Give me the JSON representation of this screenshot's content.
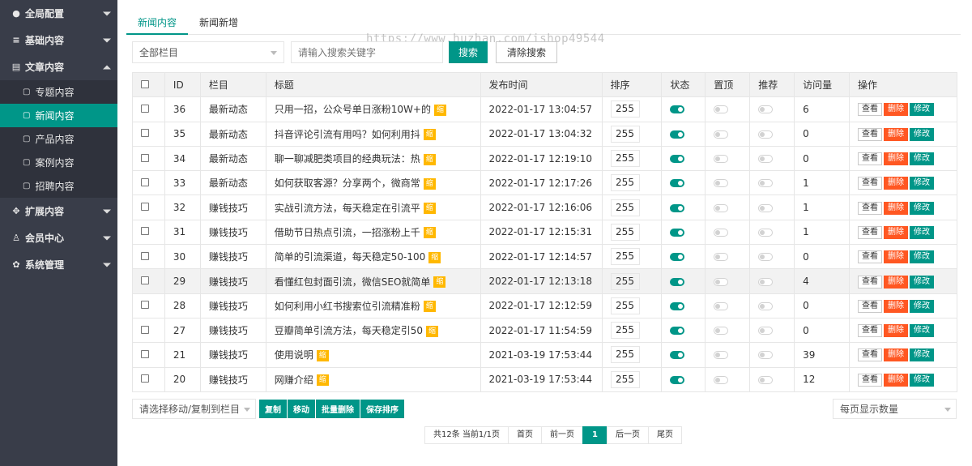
{
  "sidebar": {
    "items": [
      {
        "label": "全局配置",
        "icon": "globe-icon",
        "glyph": "●",
        "expanded": false
      },
      {
        "label": "基础内容",
        "icon": "sliders-icon",
        "glyph": "≡",
        "expanded": false
      },
      {
        "label": "文章内容",
        "icon": "document-icon",
        "glyph": "▤",
        "expanded": true
      },
      {
        "label": "扩展内容",
        "icon": "expand-icon",
        "glyph": "✥",
        "expanded": false
      },
      {
        "label": "会员中心",
        "icon": "user-icon",
        "glyph": "♙",
        "expanded": false
      },
      {
        "label": "系统管理",
        "icon": "gear-icon",
        "glyph": "✿",
        "expanded": false
      }
    ],
    "sub_items": [
      {
        "label": "专题内容",
        "active": false
      },
      {
        "label": "新闻内容",
        "active": true
      },
      {
        "label": "产品内容",
        "active": false
      },
      {
        "label": "案例内容",
        "active": false
      },
      {
        "label": "招聘内容",
        "active": false
      }
    ]
  },
  "tabs": [
    {
      "label": "新闻内容",
      "active": true
    },
    {
      "label": "新闻新增",
      "active": false
    }
  ],
  "watermark": "https://www.huzhan.com/ishop49544",
  "toolbar": {
    "category_select": "全部栏目",
    "search_placeholder": "请输入搜索关键字",
    "search_button": "搜索",
    "clear_button": "清除搜索"
  },
  "table": {
    "columns": [
      "ID",
      "栏目",
      "标题",
      "发布时间",
      "排序",
      "状态",
      "置顶",
      "推荐",
      "访问量",
      "操作"
    ],
    "tag_label": "缩",
    "op_labels": {
      "view": "查看",
      "delete": "删除",
      "edit": "修改"
    },
    "rows": [
      {
        "id": "36",
        "category": "最新动态",
        "title": "只用一招，公众号单日涨粉10W+的",
        "date": "2022-01-17 13:04:57",
        "sort": "255",
        "status": true,
        "top": false,
        "recommend": false,
        "views": "6"
      },
      {
        "id": "35",
        "category": "最新动态",
        "title": "抖音评论引流有用吗？如何利用抖",
        "date": "2022-01-17 13:04:32",
        "sort": "255",
        "status": true,
        "top": false,
        "recommend": false,
        "views": "0"
      },
      {
        "id": "34",
        "category": "最新动态",
        "title": "聊一聊减肥类项目的经典玩法：热",
        "date": "2022-01-17 12:19:10",
        "sort": "255",
        "status": true,
        "top": false,
        "recommend": false,
        "views": "0"
      },
      {
        "id": "33",
        "category": "最新动态",
        "title": "如何获取客源？分享两个，微商常",
        "date": "2022-01-17 12:17:26",
        "sort": "255",
        "status": true,
        "top": false,
        "recommend": false,
        "views": "1"
      },
      {
        "id": "32",
        "category": "赚钱技巧",
        "title": "实战引流方法，每天稳定在引流平",
        "date": "2022-01-17 12:16:06",
        "sort": "255",
        "status": true,
        "top": false,
        "recommend": false,
        "views": "1"
      },
      {
        "id": "31",
        "category": "赚钱技巧",
        "title": "借助节日热点引流，一招涨粉上千",
        "date": "2022-01-17 12:15:31",
        "sort": "255",
        "status": true,
        "top": false,
        "recommend": false,
        "views": "1"
      },
      {
        "id": "30",
        "category": "赚钱技巧",
        "title": "简单的引流渠道，每天稳定50-100",
        "date": "2022-01-17 12:14:57",
        "sort": "255",
        "status": true,
        "top": false,
        "recommend": false,
        "views": "0"
      },
      {
        "id": "29",
        "category": "赚钱技巧",
        "title": "看懂红包封面引流，微信SEO就简单",
        "date": "2022-01-17 12:13:18",
        "sort": "255",
        "status": true,
        "top": false,
        "recommend": false,
        "views": "4",
        "highlight": true
      },
      {
        "id": "28",
        "category": "赚钱技巧",
        "title": "如何利用小红书搜索位引流精准粉",
        "date": "2022-01-17 12:12:59",
        "sort": "255",
        "status": true,
        "top": false,
        "recommend": false,
        "views": "0"
      },
      {
        "id": "27",
        "category": "赚钱技巧",
        "title": "豆瓣简单引流方法，每天稳定引50",
        "date": "2022-01-17 11:54:59",
        "sort": "255",
        "status": true,
        "top": false,
        "recommend": false,
        "views": "0"
      },
      {
        "id": "21",
        "category": "赚钱技巧",
        "title": "使用说明",
        "date": "2021-03-19 17:53:44",
        "sort": "255",
        "status": true,
        "top": false,
        "recommend": false,
        "views": "39"
      },
      {
        "id": "20",
        "category": "赚钱技巧",
        "title": "网赚介绍",
        "date": "2021-03-19 17:53:44",
        "sort": "255",
        "status": true,
        "top": false,
        "recommend": false,
        "views": "12"
      }
    ]
  },
  "bottom": {
    "move_select": "请选择移动/复制到栏目",
    "buttons": [
      "复制",
      "移动",
      "批量删除",
      "保存排序"
    ],
    "per_page": "每页显示数量"
  },
  "pager": {
    "summary": "共12条 当前1/1页",
    "first": "首页",
    "prev": "前一页",
    "current": "1",
    "next": "后一页",
    "last": "尾页"
  },
  "colors": {
    "sidebar": "#393d49",
    "accent": "#009688",
    "danger": "#ff5722",
    "warn": "#ffb800"
  }
}
